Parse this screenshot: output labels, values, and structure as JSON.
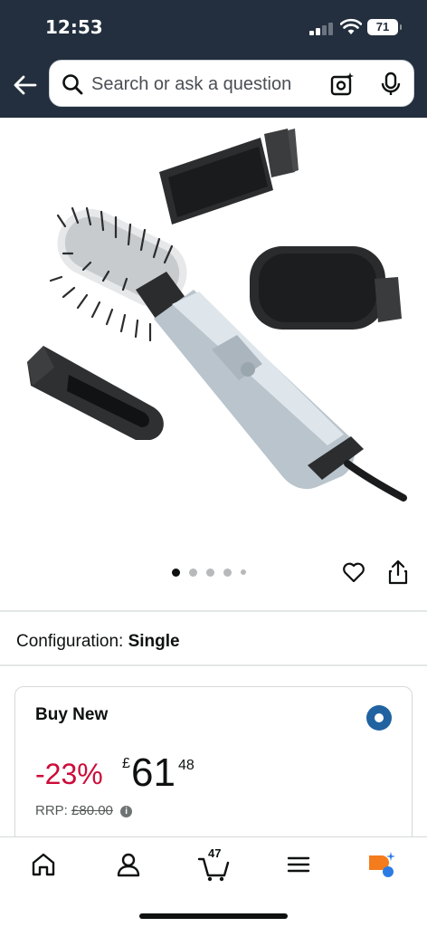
{
  "status_bar": {
    "time": "12:53",
    "battery": "71"
  },
  "search": {
    "placeholder": "Search or ask a question",
    "icons": [
      "search-icon",
      "camera-icon",
      "mic-icon"
    ]
  },
  "gallery": {
    "image_count": 5,
    "active_index": 0,
    "icons": [
      "heart-icon",
      "share-icon"
    ]
  },
  "configuration": {
    "label": "Configuration:",
    "value": "Single"
  },
  "buy_box": {
    "title": "Buy New",
    "discount": "-23%",
    "currency": "£",
    "price_whole": "61",
    "price_fraction": "48",
    "rrp_label": "RRP:",
    "rrp_value": "£80.00"
  },
  "bottom_nav": {
    "items": [
      "home-icon",
      "account-icon",
      "cart-icon",
      "menu-icon",
      "rufus-icon"
    ],
    "cart_count": "47"
  },
  "colors": {
    "header_bg": "#232f3e",
    "discount": "#cc0c39",
    "radio": "#2162a1",
    "rufus_orange": "#f47c1c",
    "rufus_blue": "#2c7be5"
  }
}
